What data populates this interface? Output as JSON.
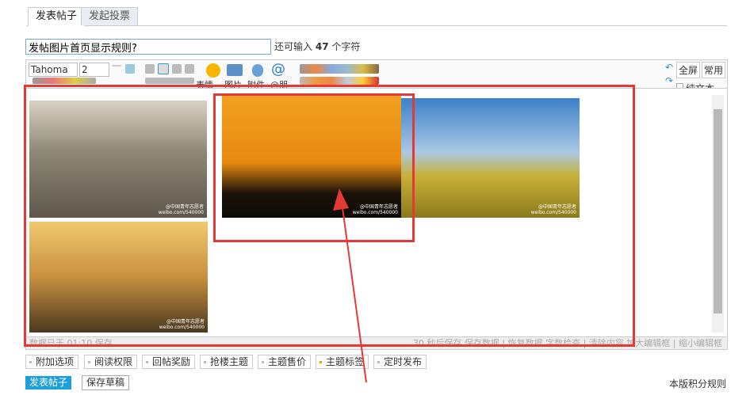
{
  "tabs": [
    {
      "label": "发表帖子",
      "active": true
    },
    {
      "label": "发起投票",
      "active": false
    }
  ],
  "title": {
    "value": "发帖图片首页显示规则?",
    "remaining_prefix": "还可输入",
    "remaining_count": "47",
    "remaining_suffix": "个字符"
  },
  "toolbar": {
    "font": "Tahoma",
    "size": "2",
    "emoji_label": "表情",
    "image_label": "图片",
    "attach_label": "附件",
    "at_label": "@朋",
    "fullscreen": "全屏",
    "common": "常用",
    "plaintext": "纯文本"
  },
  "photos": [
    {
      "watermark": "@中国青年志愿者",
      "url": "weibo.com/540000"
    }
  ],
  "status": {
    "left": "数据已于 01:10 保存",
    "right": "30 秒后保存 保存数据 | 恢复数据    字数检查 | 清除内容    加大编辑框 | 缩小编辑框"
  },
  "options": [
    "附加选项",
    "阅读权限",
    "回帖奖励",
    "抢楼主题",
    "主题售价",
    "主题标签",
    "定时发布"
  ],
  "actions": {
    "submit": "发表帖子",
    "draft": "保存草稿",
    "rules": "本版积分规则"
  },
  "colors": {
    "accent": "#1e9fd8",
    "annotation": "#e53935"
  }
}
